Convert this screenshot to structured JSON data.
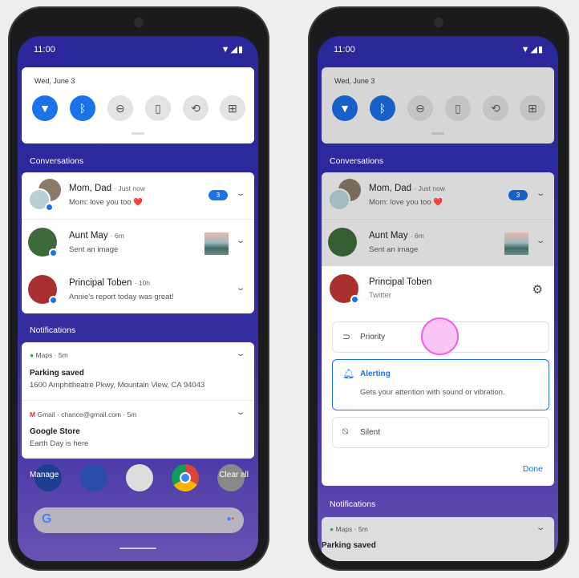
{
  "status": {
    "time": "11:00",
    "icons": [
      "wifi-icon",
      "signal-icon",
      "battery-icon"
    ]
  },
  "quick_settings": {
    "date": "Wed, June 3",
    "tiles": [
      {
        "name": "wifi",
        "icon": "▼",
        "on": true
      },
      {
        "name": "bluetooth",
        "icon": "ᛒ",
        "on": true
      },
      {
        "name": "do-not-disturb",
        "icon": "⊖",
        "on": false
      },
      {
        "name": "flashlight",
        "icon": "▯",
        "on": false
      },
      {
        "name": "auto-rotate",
        "icon": "⟲",
        "on": false
      },
      {
        "name": "battery-saver",
        "icon": "⊞",
        "on": false
      }
    ]
  },
  "conversations": {
    "label": "Conversations",
    "items": [
      {
        "name": "Mom, Dad",
        "time": "Just now",
        "message": "Mom: love you too ❤️",
        "count": "3"
      },
      {
        "name": "Aunt May",
        "time": "6m",
        "message": "Sent an image"
      },
      {
        "name": "Principal Toben",
        "time": "10h",
        "message": "Annie's report today was great!"
      }
    ]
  },
  "notifications": {
    "label": "Notifications",
    "items": [
      {
        "app": "Maps",
        "time": "5m",
        "title": "Parking saved",
        "body": "1600 Amphitheatre Pkwy, Mountain View, CA 94043"
      },
      {
        "app": "Gmail",
        "account": "chance@gmail.com",
        "time": "5m",
        "title": "Google Store",
        "body": "Earth Day is here"
      }
    ]
  },
  "shade_actions": {
    "manage": "Manage",
    "clear_all": "Clear all"
  },
  "expanded": {
    "name": "Principal Toben",
    "app": "Twitter",
    "options": [
      {
        "label": "Priority",
        "icon": "priority-icon"
      },
      {
        "label": "Alerting",
        "icon": "bell-icon",
        "description": "Gets your attention with sound or vibration.",
        "selected": true
      },
      {
        "label": "Silent",
        "icon": "bell-off-icon"
      }
    ],
    "done": "Done"
  },
  "colors": {
    "accent": "#1a73e8",
    "shade": "#2a279a",
    "touch": "#f7b6f2"
  }
}
